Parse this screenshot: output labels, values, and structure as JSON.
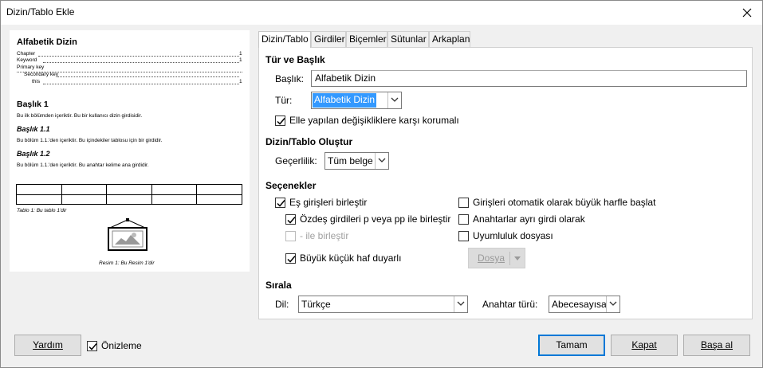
{
  "window": {
    "title": "Dizin/Tablo Ekle"
  },
  "icons": {
    "close": "close-icon",
    "checkmark": "checkmark-icon",
    "dropdown": "chevron-down-icon"
  },
  "preview": {
    "title": "Alfabetik Dizin",
    "index_entries": [
      {
        "text": "Chapter",
        "page": "1"
      },
      {
        "text": "Keyword",
        "page": "1"
      },
      {
        "text": "Primary key",
        "page": ""
      },
      {
        "text": "Secondary key",
        "page": ""
      },
      {
        "text": "this",
        "page": "1"
      }
    ],
    "heading1": "Başlık 1",
    "body1": "Bu ilk bölümden içeriktir. Bu bir kullanıcı dizin girdisidir.",
    "heading11": "Başlık 1.1",
    "body11": "Bu bölüm 1.1.'den içeriktir. Bu içindekiler tablosu için bir girdidir.",
    "heading12": "Başlık 1.2",
    "body12": "Bu bölüm 1.1.'den içeriktir. Bu anahtar kelime ana girdidir.",
    "table_caption": "Tablo 1: Bu tablo 1'dir",
    "image_caption": "Resim 1: Bu Resim 1'dir"
  },
  "tabs": [
    {
      "label": "Dizin/Tablo",
      "active": true
    },
    {
      "label": "Girdiler",
      "active": false
    },
    {
      "label": "Biçemler",
      "active": false
    },
    {
      "label": "Sütunlar",
      "active": false
    },
    {
      "label": "Arkaplan",
      "active": false
    }
  ],
  "type_title": {
    "section": "Tür ve Başlık",
    "title_label": "Başlık:",
    "title_value": "Alfabetik Dizin",
    "type_label": "Tür:",
    "type_value": "Alfabetik Dizin",
    "protect_label": "Elle yapılan değişikliklere karşı korumalı",
    "protect_checked": true
  },
  "create": {
    "section": "Dizin/Tablo Oluştur",
    "scope_label": "Geçerlilik:",
    "scope_value": "Tüm belge"
  },
  "options": {
    "section": "Seçenekler",
    "combine_identical": {
      "label": "Eş girişleri birleştir",
      "checked": true
    },
    "combine_pp": {
      "label": "Özdeş girdileri p veya pp ile birleştir",
      "checked": true
    },
    "combine_dash": {
      "label": "- ile birleştir",
      "checked": false,
      "disabled": true
    },
    "case_sensitive": {
      "label": "Büyük küçük haf duyarlı",
      "checked": true
    },
    "auto_capitalize": {
      "label": "Girişleri otomatik olarak büyük harfle başlat",
      "checked": false
    },
    "keys_separate": {
      "label": "Anahtarlar ayrı girdi olarak",
      "checked": false
    },
    "concordance": {
      "label": "Uyumluluk dosyası",
      "checked": false
    },
    "file_button": "Dosya"
  },
  "sort": {
    "section": "Sırala",
    "language_label": "Dil:",
    "language_value": "Türkçe",
    "key_type_label": "Anahtar türü:",
    "key_type_value": "Abecesayısal"
  },
  "footer": {
    "help": "Yardım",
    "preview_label": "Önizleme",
    "preview_checked": true,
    "ok": "Tamam",
    "close": "Kapat",
    "reset": "Başa al"
  }
}
